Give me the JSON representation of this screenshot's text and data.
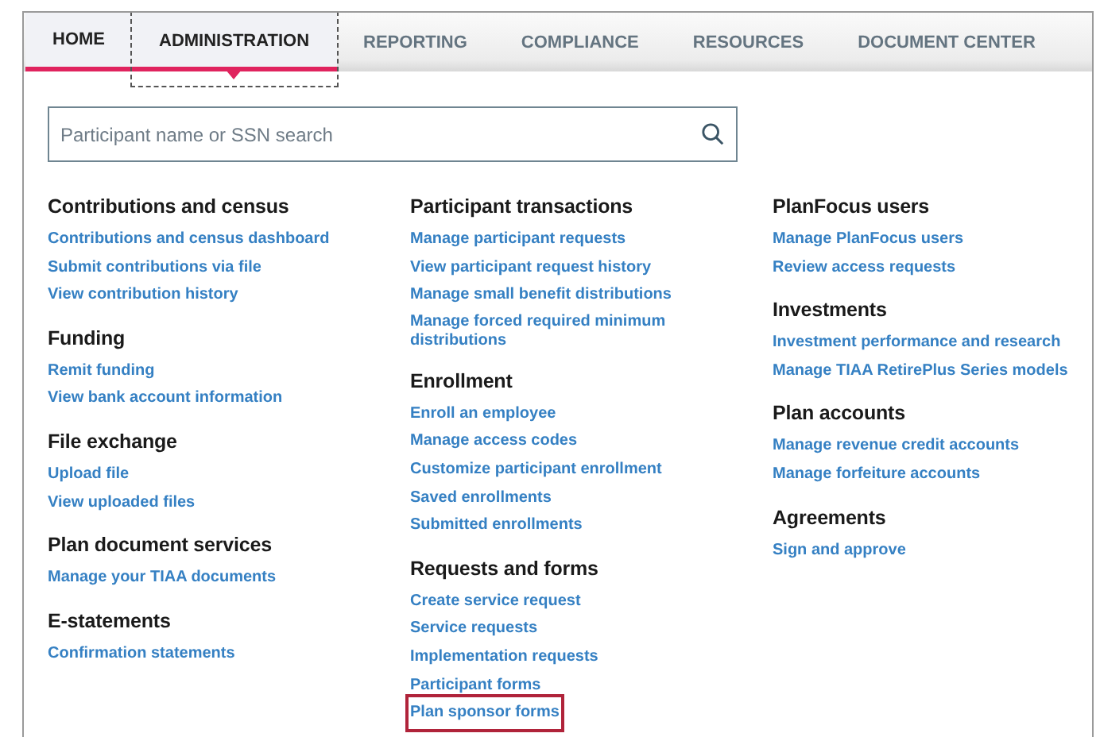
{
  "tabs": [
    {
      "label": "HOME",
      "underlined": true,
      "selected": false
    },
    {
      "label": "ADMINISTRATION",
      "underlined": true,
      "selected": true
    },
    {
      "label": "REPORTING",
      "underlined": false,
      "selected": false
    },
    {
      "label": "COMPLIANCE",
      "underlined": false,
      "selected": false
    },
    {
      "label": "RESOURCES",
      "underlined": false,
      "selected": false
    },
    {
      "label": "DOCUMENT CENTER",
      "underlined": false,
      "selected": false
    }
  ],
  "search": {
    "placeholder": "Participant name or SSN search"
  },
  "columns": [
    [
      {
        "heading": "Contributions and census",
        "links": [
          {
            "label": "Contributions and census dashboard",
            "highlighted": false
          },
          {
            "label": "Submit contributions via file",
            "highlighted": false
          },
          {
            "label": "View contribution history",
            "highlighted": false
          }
        ]
      },
      {
        "heading": "Funding",
        "links": [
          {
            "label": "Remit funding",
            "highlighted": false
          },
          {
            "label": "View bank account information",
            "highlighted": false
          }
        ]
      },
      {
        "heading": "File exchange",
        "links": [
          {
            "label": "Upload file",
            "highlighted": false
          },
          {
            "label": "View uploaded files",
            "highlighted": false
          }
        ]
      },
      {
        "heading": "Plan document services",
        "links": [
          {
            "label": "Manage your TIAA documents",
            "highlighted": false
          }
        ]
      },
      {
        "heading": "E-statements",
        "links": [
          {
            "label": "Confirmation statements",
            "highlighted": false
          }
        ]
      }
    ],
    [
      {
        "heading": "Participant transactions",
        "links": [
          {
            "label": "Manage participant requests",
            "highlighted": false
          },
          {
            "label": "View participant request history",
            "highlighted": false
          },
          {
            "label": "Manage small benefit distributions",
            "highlighted": false
          },
          {
            "label": "Manage forced required minimum distributions",
            "highlighted": false
          }
        ]
      },
      {
        "heading": "Enrollment",
        "links": [
          {
            "label": "Enroll an employee",
            "highlighted": false
          },
          {
            "label": "Manage access codes",
            "highlighted": false
          },
          {
            "label": "Customize participant enrollment",
            "highlighted": false
          },
          {
            "label": "Saved enrollments",
            "highlighted": false
          },
          {
            "label": "Submitted enrollments",
            "highlighted": false
          }
        ]
      },
      {
        "heading": "Requests and forms",
        "links": [
          {
            "label": "Create service request",
            "highlighted": false
          },
          {
            "label": "Service requests",
            "highlighted": false
          },
          {
            "label": "Implementation requests",
            "highlighted": false
          },
          {
            "label": "Participant forms",
            "highlighted": false
          },
          {
            "label": "Plan sponsor forms",
            "highlighted": true
          }
        ]
      }
    ],
    [
      {
        "heading": "PlanFocus users",
        "links": [
          {
            "label": "Manage PlanFocus users",
            "highlighted": false
          },
          {
            "label": "Review access requests",
            "highlighted": false
          }
        ]
      },
      {
        "heading": "Investments",
        "links": [
          {
            "label": "Investment performance and research",
            "highlighted": false
          },
          {
            "label": "Manage TIAA RetirePlus Series models",
            "highlighted": false
          }
        ]
      },
      {
        "heading": "Plan accounts",
        "links": [
          {
            "label": "Manage revenue credit accounts",
            "highlighted": false
          },
          {
            "label": "Manage forfeiture accounts",
            "highlighted": false
          }
        ]
      },
      {
        "heading": "Agreements",
        "links": [
          {
            "label": "Sign and approve",
            "highlighted": false
          }
        ]
      }
    ]
  ]
}
